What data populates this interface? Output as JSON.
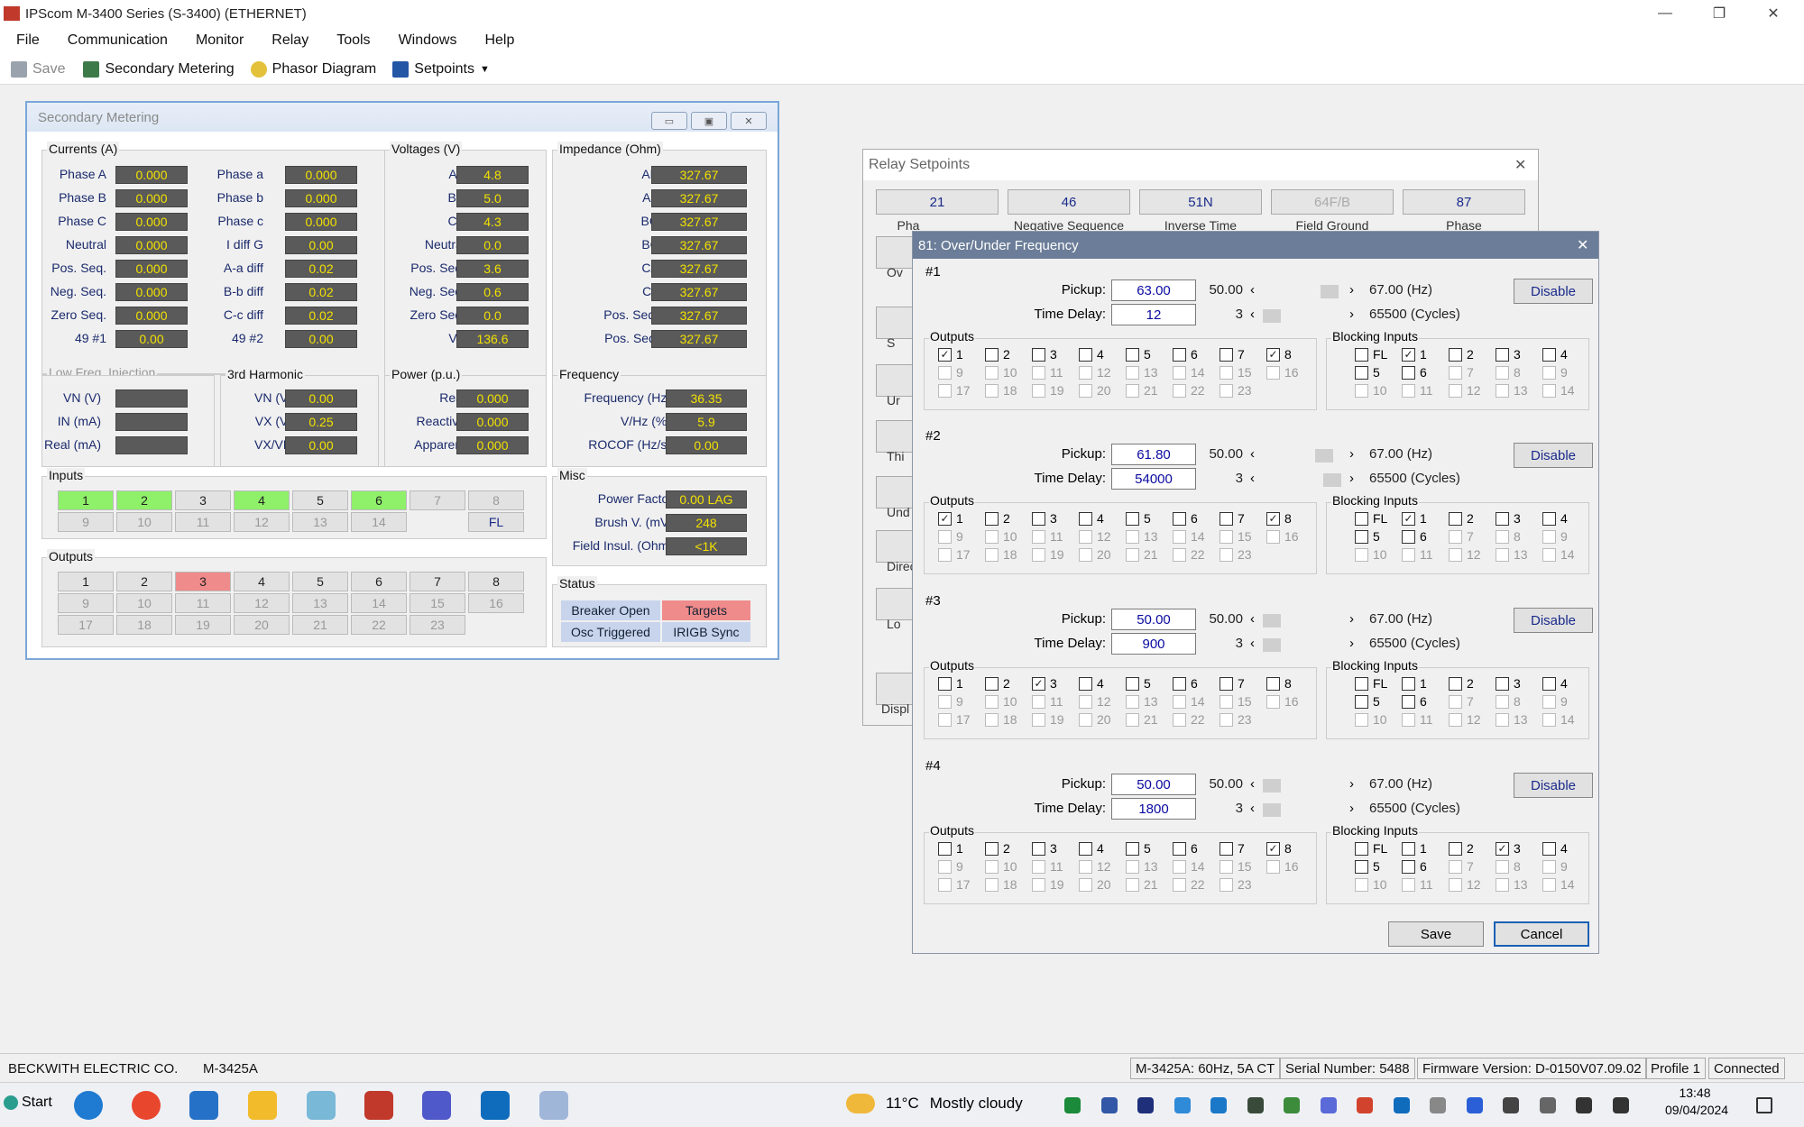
{
  "app": {
    "title": "IPScom M-3400 Series (S-3400) (ETHERNET)"
  },
  "menu": [
    "File",
    "Communication",
    "Monitor",
    "Relay",
    "Tools",
    "Windows",
    "Help"
  ],
  "toolbar": {
    "save": "Save",
    "secondary_metering": "Secondary Metering",
    "phasor_diagram": "Phasor Diagram",
    "setpoints": "Setpoints"
  },
  "sm": {
    "title": "Secondary Metering",
    "currents": {
      "label": "Currents (A)",
      "rows": [
        [
          "Phase A",
          "0.000",
          "Phase a",
          "0.000"
        ],
        [
          "Phase B",
          "0.000",
          "Phase b",
          "0.000"
        ],
        [
          "Phase C",
          "0.000",
          "Phase c",
          "0.000"
        ],
        [
          "Neutral",
          "0.000",
          "I diff G",
          "0.00"
        ],
        [
          "Pos. Seq.",
          "0.000",
          "A-a diff",
          "0.02"
        ],
        [
          "Neg. Seq.",
          "0.000",
          "B-b diff",
          "0.02"
        ],
        [
          "Zero Seq.",
          "0.000",
          "C-c diff",
          "0.02"
        ],
        [
          "49 #1",
          "0.00",
          "49 #2",
          "0.00"
        ]
      ]
    },
    "voltages": {
      "label": "Voltages (V)",
      "rows": [
        [
          "AB",
          "4.8"
        ],
        [
          "BC",
          "5.0"
        ],
        [
          "CA",
          "4.3"
        ],
        [
          "Neutral",
          "0.0"
        ],
        [
          "Pos. Seq.",
          "3.6"
        ],
        [
          "Neg. Seq.",
          "0.6"
        ],
        [
          "Zero Seq.",
          "0.0"
        ],
        [
          "VX",
          "136.6"
        ]
      ]
    },
    "impedance": {
      "label": "Impedance (Ohm)",
      "rows": [
        [
          "AB R",
          "327.67"
        ],
        [
          "AB X",
          "327.67"
        ],
        [
          "BC R",
          "327.67"
        ],
        [
          "BC X",
          "327.67"
        ],
        [
          "CA R",
          "327.67"
        ],
        [
          "CA X",
          "327.67"
        ],
        [
          "Pos. Seq. R",
          "327.67"
        ],
        [
          "Pos. Seq. X",
          "327.67"
        ]
      ]
    },
    "lfi": {
      "label": "Low Freq. Injection",
      "rows": [
        [
          "VN (V)",
          ""
        ],
        [
          "IN (mA)",
          ""
        ],
        [
          "Real (mA)",
          ""
        ]
      ]
    },
    "harm": {
      "label": "3rd Harmonic",
      "rows": [
        [
          "VN (V)",
          "0.00"
        ],
        [
          "VX (V)",
          "0.25"
        ],
        [
          "VX/VN",
          "0.00"
        ]
      ]
    },
    "power": {
      "label": "Power (p.u.)",
      "rows": [
        [
          "Real",
          "0.000"
        ],
        [
          "Reactive",
          "0.000"
        ],
        [
          "Apparent",
          "0.000"
        ]
      ]
    },
    "freq": {
      "label": "Frequency",
      "rows": [
        [
          "Frequency (Hz)",
          "36.35"
        ],
        [
          "V/Hz (%)",
          "5.9"
        ],
        [
          "ROCOF (Hz/s)",
          "0.00"
        ]
      ]
    },
    "misc": {
      "label": "Misc",
      "rows": [
        [
          "Power Factor",
          "0.00 LAG"
        ],
        [
          "Brush V. (mV)",
          "248"
        ],
        [
          "Field Insul. (Ohm)",
          "<1K"
        ]
      ]
    },
    "inputs": {
      "label": "Inputs",
      "row1": [
        "1",
        "2",
        "3",
        "4",
        "5",
        "6",
        "7",
        "8"
      ],
      "row2": [
        "9",
        "10",
        "11",
        "12",
        "13",
        "14",
        "",
        "FL"
      ]
    },
    "outputs": {
      "label": "Outputs",
      "row1": [
        "1",
        "2",
        "3",
        "4",
        "5",
        "6",
        "7",
        "8"
      ],
      "row2": [
        "9",
        "10",
        "11",
        "12",
        "13",
        "14",
        "15",
        "16"
      ],
      "row3": [
        "17",
        "18",
        "19",
        "20",
        "21",
        "22",
        "23"
      ]
    },
    "status": {
      "label": "Status",
      "items": [
        "Breaker Open",
        "Targets",
        "Osc Triggered",
        "IRIGB Sync"
      ]
    }
  },
  "rs": {
    "title": "Relay Setpoints",
    "tabs": [
      [
        "21",
        "Pha"
      ],
      [
        "46",
        "Negative Sequence"
      ],
      [
        "51N",
        "Inverse Time"
      ],
      [
        "64F/B",
        "Field Ground"
      ],
      [
        "87",
        "Phase"
      ]
    ],
    "side": [
      "Ov",
      "S",
      "Ur",
      "Thi",
      "Und",
      "Direc",
      "Lo",
      "Displ"
    ]
  },
  "fd": {
    "title": "81: Over/Under Frequency",
    "pickup_label": "Pickup:",
    "delay_label": "Time Delay:",
    "outputs_label": "Outputs",
    "blocking_label": "Blocking Inputs",
    "min_pickup": "50.00",
    "max_pickup": "67.00 (Hz)",
    "min_delay": "3",
    "max_delay": "65500 (Cycles)",
    "disable": "Disable",
    "sections": [
      {
        "num": "#1",
        "pickup": "63.00",
        "delay": "12"
      },
      {
        "num": "#2",
        "pickup": "61.80",
        "delay": "54000"
      },
      {
        "num": "#3",
        "pickup": "50.00",
        "delay": "900"
      },
      {
        "num": "#4",
        "pickup": "50.00",
        "delay": "1800"
      }
    ],
    "out_labels": [
      "1",
      "2",
      "3",
      "4",
      "5",
      "6",
      "7",
      "8",
      "9",
      "10",
      "11",
      "12",
      "13",
      "14",
      "15",
      "16",
      "17",
      "18",
      "19",
      "20",
      "21",
      "22",
      "23"
    ],
    "blk_labels": [
      "FL",
      "1",
      "2",
      "3",
      "4",
      "5",
      "6",
      "7",
      "8",
      "9",
      "10",
      "11",
      "12",
      "13",
      "14"
    ],
    "save": "Save",
    "cancel": "Cancel"
  },
  "statusbar": {
    "company": "BECKWITH ELECTRIC CO.",
    "model": "M-3425A",
    "config": "M-3425A: 60Hz, 5A CT",
    "serial": "Serial Number: 5488",
    "firmware": "Firmware Version: D-0150V07.09.02",
    "profile": "Profile 1",
    "conn": "Connected"
  },
  "taskbar": {
    "start": "Start",
    "weather_temp": "11°C",
    "weather_desc": "Mostly cloudy",
    "time": "13:48",
    "date": "09/04/2024"
  }
}
